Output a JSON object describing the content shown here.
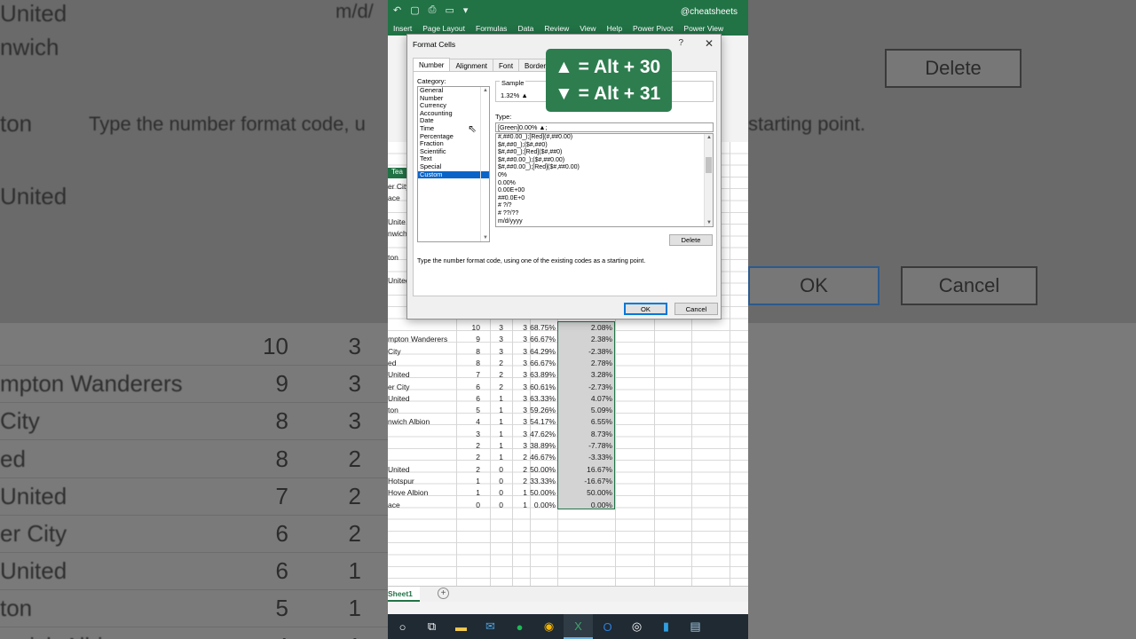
{
  "ribbon": {
    "brand": "@cheatsheets",
    "tabs": [
      "Insert",
      "Page Layout",
      "Formulas",
      "Data",
      "Review",
      "View",
      "Help",
      "Power Pivot",
      "Power View"
    ]
  },
  "left_bg": {
    "top_text": "Type the number format code, u",
    "format_text": "m/d/",
    "teams": [
      "United",
      "nwich",
      "ton",
      "United"
    ],
    "rows": [
      {
        "name": "",
        "a": "10",
        "b": "3"
      },
      {
        "name": "mpton Wanderers",
        "a": "9",
        "b": "3"
      },
      {
        "name": "City",
        "a": "8",
        "b": "3"
      },
      {
        "name": "ed",
        "a": "8",
        "b": "2"
      },
      {
        "name": "United",
        "a": "7",
        "b": "2"
      },
      {
        "name": "er City",
        "a": "6",
        "b": "2"
      },
      {
        "name": "United",
        "a": "6",
        "b": "1"
      },
      {
        "name": "ton",
        "a": "5",
        "b": "1"
      },
      {
        "name": "nwich Albion",
        "a": "4",
        "b": "1"
      }
    ]
  },
  "right_bg": {
    "top_text": "starting point.",
    "delete_label": "Delete",
    "ok_label": "OK",
    "cancel_label": "Cancel"
  },
  "sheet": {
    "tab_label": "Sheet1",
    "side_names": [
      "er City",
      "ace",
      "Unite",
      "nwich",
      "ton",
      "United"
    ],
    "header_partial": "Tea",
    "rows": [
      {
        "name": "",
        "a": "10",
        "b": "3",
        "c": "3",
        "pct": "68.75%",
        "diff": "2.08%"
      },
      {
        "name": "mpton Wanderers",
        "a": "9",
        "b": "3",
        "c": "3",
        "pct": "66.67%",
        "diff": "2.38%"
      },
      {
        "name": "City",
        "a": "8",
        "b": "3",
        "c": "3",
        "pct": "64.29%",
        "diff": "-2.38%"
      },
      {
        "name": "ed",
        "a": "8",
        "b": "2",
        "c": "3",
        "pct": "66.67%",
        "diff": "2.78%"
      },
      {
        "name": "United",
        "a": "7",
        "b": "2",
        "c": "3",
        "pct": "63.89%",
        "diff": "3.28%"
      },
      {
        "name": "er City",
        "a": "6",
        "b": "2",
        "c": "3",
        "pct": "60.61%",
        "diff": "-2.73%"
      },
      {
        "name": "United",
        "a": "6",
        "b": "1",
        "c": "3",
        "pct": "63.33%",
        "diff": "4.07%"
      },
      {
        "name": "ton",
        "a": "5",
        "b": "1",
        "c": "3",
        "pct": "59.26%",
        "diff": "5.09%"
      },
      {
        "name": "nwich Albion",
        "a": "4",
        "b": "1",
        "c": "3",
        "pct": "54.17%",
        "diff": "6.55%"
      },
      {
        "name": "",
        "a": "3",
        "b": "1",
        "c": "3",
        "pct": "47.62%",
        "diff": "8.73%"
      },
      {
        "name": "",
        "a": "2",
        "b": "1",
        "c": "3",
        "pct": "38.89%",
        "diff": "-7.78%"
      },
      {
        "name": "",
        "a": "2",
        "b": "1",
        "c": "2",
        "pct": "46.67%",
        "diff": "-3.33%"
      },
      {
        "name": "United",
        "a": "2",
        "b": "0",
        "c": "2",
        "pct": "50.00%",
        "diff": "16.67%"
      },
      {
        "name": "Hotspur",
        "a": "1",
        "b": "0",
        "c": "2",
        "pct": "33.33%",
        "diff": "-16.67%"
      },
      {
        "name": "Hove Albion",
        "a": "1",
        "b": "0",
        "c": "1",
        "pct": "50.00%",
        "diff": "50.00%"
      },
      {
        "name": "ace",
        "a": "0",
        "b": "0",
        "c": "1",
        "pct": "0.00%",
        "diff": "0.00%"
      }
    ]
  },
  "dialog": {
    "title": "Format Cells",
    "help": "?",
    "close": "✕",
    "tabs": [
      "Number",
      "Alignment",
      "Font",
      "Border"
    ],
    "category_label": "Category:",
    "categories": [
      "General",
      "Number",
      "Currency",
      "Accounting",
      "Date",
      "Time",
      "Percentage",
      "Fraction",
      "Scientific",
      "Text",
      "Special",
      "Custom"
    ],
    "selected_category": "Custom",
    "sample_label": "Sample",
    "sample_value": "1.32% ▲",
    "type_label": "Type:",
    "type_value": "[Green]0.00% ▲;",
    "formats": [
      "#,##0.00_);[Red](#,##0.00)",
      "$#,##0_);($#,##0)",
      "$#,##0_);[Red]($#,##0)",
      "$#,##0.00_);($#,##0.00)",
      "$#,##0.00_);[Red]($#,##0.00)",
      "0%",
      "0.00%",
      "0.00E+00",
      "##0.0E+0",
      "# ?/?",
      "# ??/??",
      "m/d/yyyy"
    ],
    "delete_label": "Delete",
    "hint": "Type the number format code, using one of the existing codes as a starting point.",
    "ok_label": "OK",
    "cancel_label": "Cancel"
  },
  "shortcut_badge": {
    "up_line": "▲ = Alt + 30",
    "down_line": "▼ = Alt + 31"
  },
  "colors": {
    "excel_green": "#217346",
    "badge_green": "#2e7d4f",
    "selection_blue": "#0a64c8"
  }
}
